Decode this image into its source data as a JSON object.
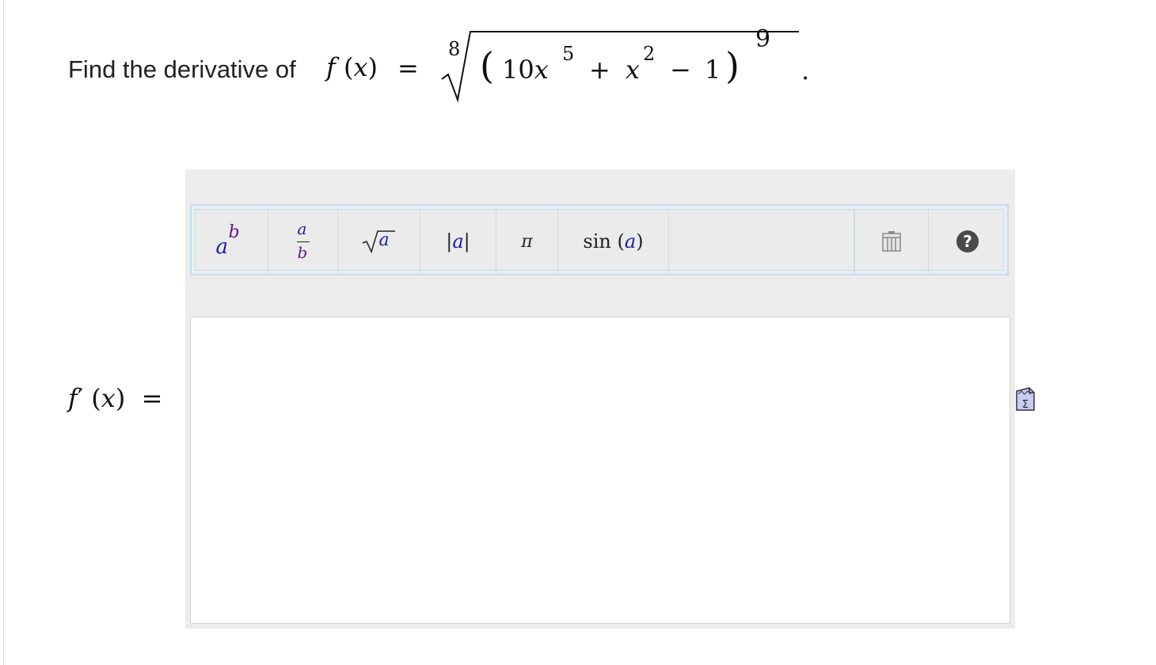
{
  "problem": {
    "lead": "Find the derivative of",
    "f": "f",
    "x": "x",
    "lparen": "(",
    "rparen": ")",
    "equals": "=",
    "root_index": "8",
    "coef": "10",
    "exp1": "5",
    "plus": "+",
    "exp2": "2",
    "minus": "−",
    "one": "1",
    "outer_exp": "9",
    "period": "."
  },
  "toolbar": {
    "power": {
      "base": "a",
      "exp": "b"
    },
    "fraction": {
      "num": "a",
      "den": "b"
    },
    "sqrt": {
      "radicand": "a"
    },
    "abs": {
      "bar_l": "|",
      "val": "a",
      "bar_r": "|"
    },
    "pi": "π",
    "sin": {
      "fn": "sin",
      "lparen": "(",
      "arg": "a",
      "rparen": ")"
    },
    "icons": [
      "keyboard-icon",
      "help-icon"
    ]
  },
  "answer": {
    "label_f": "f",
    "prime": "′",
    "lparen": "(",
    "x": "x",
    "rparen": ")",
    "equals": "=",
    "value": ""
  },
  "preview": {
    "symbol": "Σ"
  }
}
